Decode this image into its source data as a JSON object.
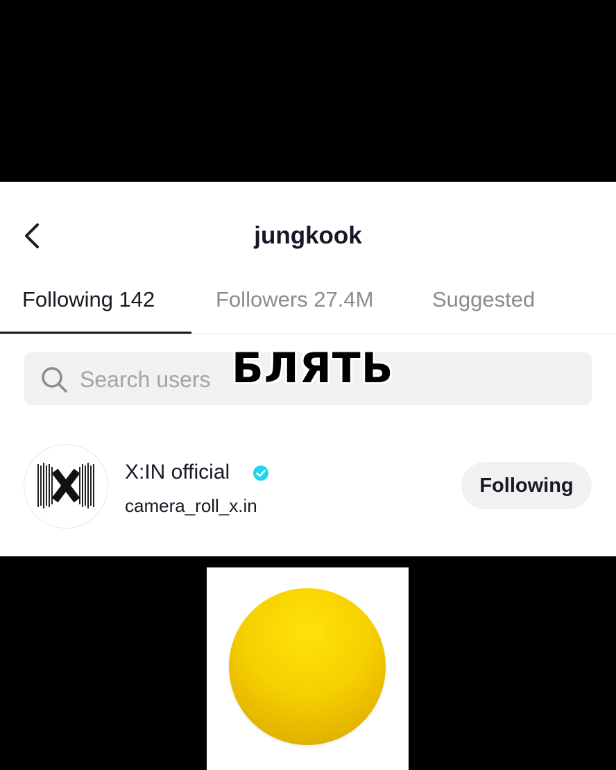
{
  "header": {
    "title": "jungkook",
    "back_icon": "chevron-left-icon"
  },
  "tabs": [
    {
      "label": "Following 142",
      "active": true
    },
    {
      "label": "Followers 27.4M",
      "active": false
    },
    {
      "label": "Suggested",
      "active": false
    }
  ],
  "search": {
    "placeholder": "Search users",
    "icon": "search-icon"
  },
  "users": [
    {
      "display_name": "X:IN official",
      "verified": true,
      "username": "camera_roll_x.in",
      "button_label": "Following"
    }
  ],
  "overlay": {
    "caption": "БЛЯТЬ"
  },
  "colors": {
    "verified_badge": "#20d5ec",
    "ball": "#f6d000",
    "text_primary": "#161823",
    "text_secondary": "#8a8b91"
  }
}
